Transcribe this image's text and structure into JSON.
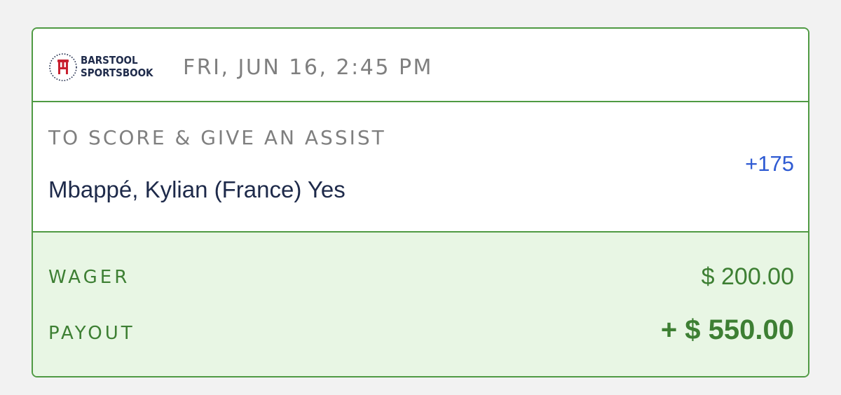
{
  "header": {
    "brand_line1": "BARSTOOL",
    "brand_line2": "SPORTSBOOK",
    "logo_icon": "barstool-logo-icon",
    "timestamp": "FRI, JUN 16, 2:45 PM"
  },
  "bet": {
    "market": "TO SCORE & GIVE AN ASSIST",
    "selection": "Mbappé, Kylian (France) Yes",
    "odds": "+175"
  },
  "summary": {
    "wager_label": "WAGER",
    "wager_amount": "$ 200.00",
    "payout_label": "PAYOUT",
    "payout_amount": "+ $ 550.00"
  },
  "colors": {
    "border_green": "#4f9a43",
    "summary_bg": "#e8f6e4",
    "summary_text": "#3d7f33",
    "odds_blue": "#2f5bd3",
    "navy": "#1e2a4a",
    "brand_red": "#c8202f"
  }
}
